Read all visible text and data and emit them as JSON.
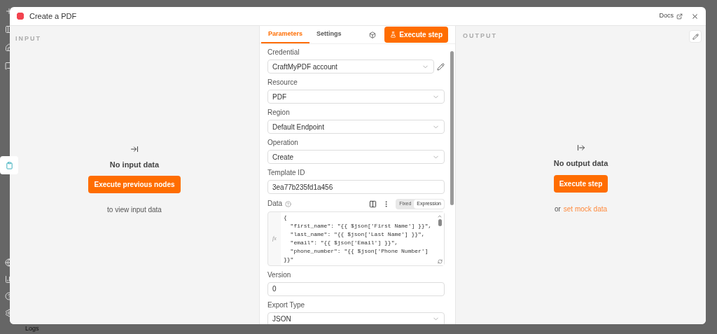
{
  "background": {
    "logs_label": "Logs"
  },
  "modal": {
    "title": "Create a PDF",
    "docs_link": "Docs"
  },
  "input_panel": {
    "heading": "INPUT",
    "message": "No input data",
    "button": "Execute previous nodes",
    "hint": "to view input data"
  },
  "node_panel": {
    "tabs": [
      {
        "label": "Parameters",
        "selected": true
      },
      {
        "label": "Settings",
        "selected": false
      }
    ],
    "execute_button": "Execute step",
    "fields": [
      {
        "kind": "select",
        "label": "Credential",
        "value": "CraftMyPDF account",
        "editable": true
      },
      {
        "kind": "select",
        "label": "Resource",
        "value": "PDF"
      },
      {
        "kind": "select",
        "label": "Region",
        "value": "Default Endpoint"
      },
      {
        "kind": "select",
        "label": "Operation",
        "value": "Create"
      },
      {
        "kind": "text",
        "label": "Template ID",
        "value": "3ea77b235fd1a456"
      },
      {
        "kind": "code",
        "label": "Data",
        "gutter_label": "fx",
        "modes": [
          {
            "label": "Fixed",
            "selected": false
          },
          {
            "label": "Expression",
            "selected": true
          }
        ],
        "lines": [
          "{",
          "  \"first_name\": \"{{ $json['First Name'] }}\",",
          "  \"last_name\": \"{{ $json['Last Name'] }}\",",
          "  \"email\": \"{{ $json['Email'] }}\",",
          "  \"phone_number\": \"{{ $json['Phone Number']",
          "}}\""
        ]
      },
      {
        "kind": "text",
        "label": "Version",
        "value": "0"
      },
      {
        "kind": "select",
        "label": "Export Type",
        "value": "JSON"
      }
    ]
  },
  "output_panel": {
    "heading": "OUTPUT",
    "message": "No output data",
    "button": "Execute step",
    "hint_prefix": "or",
    "hint_link": "set mock data"
  }
}
